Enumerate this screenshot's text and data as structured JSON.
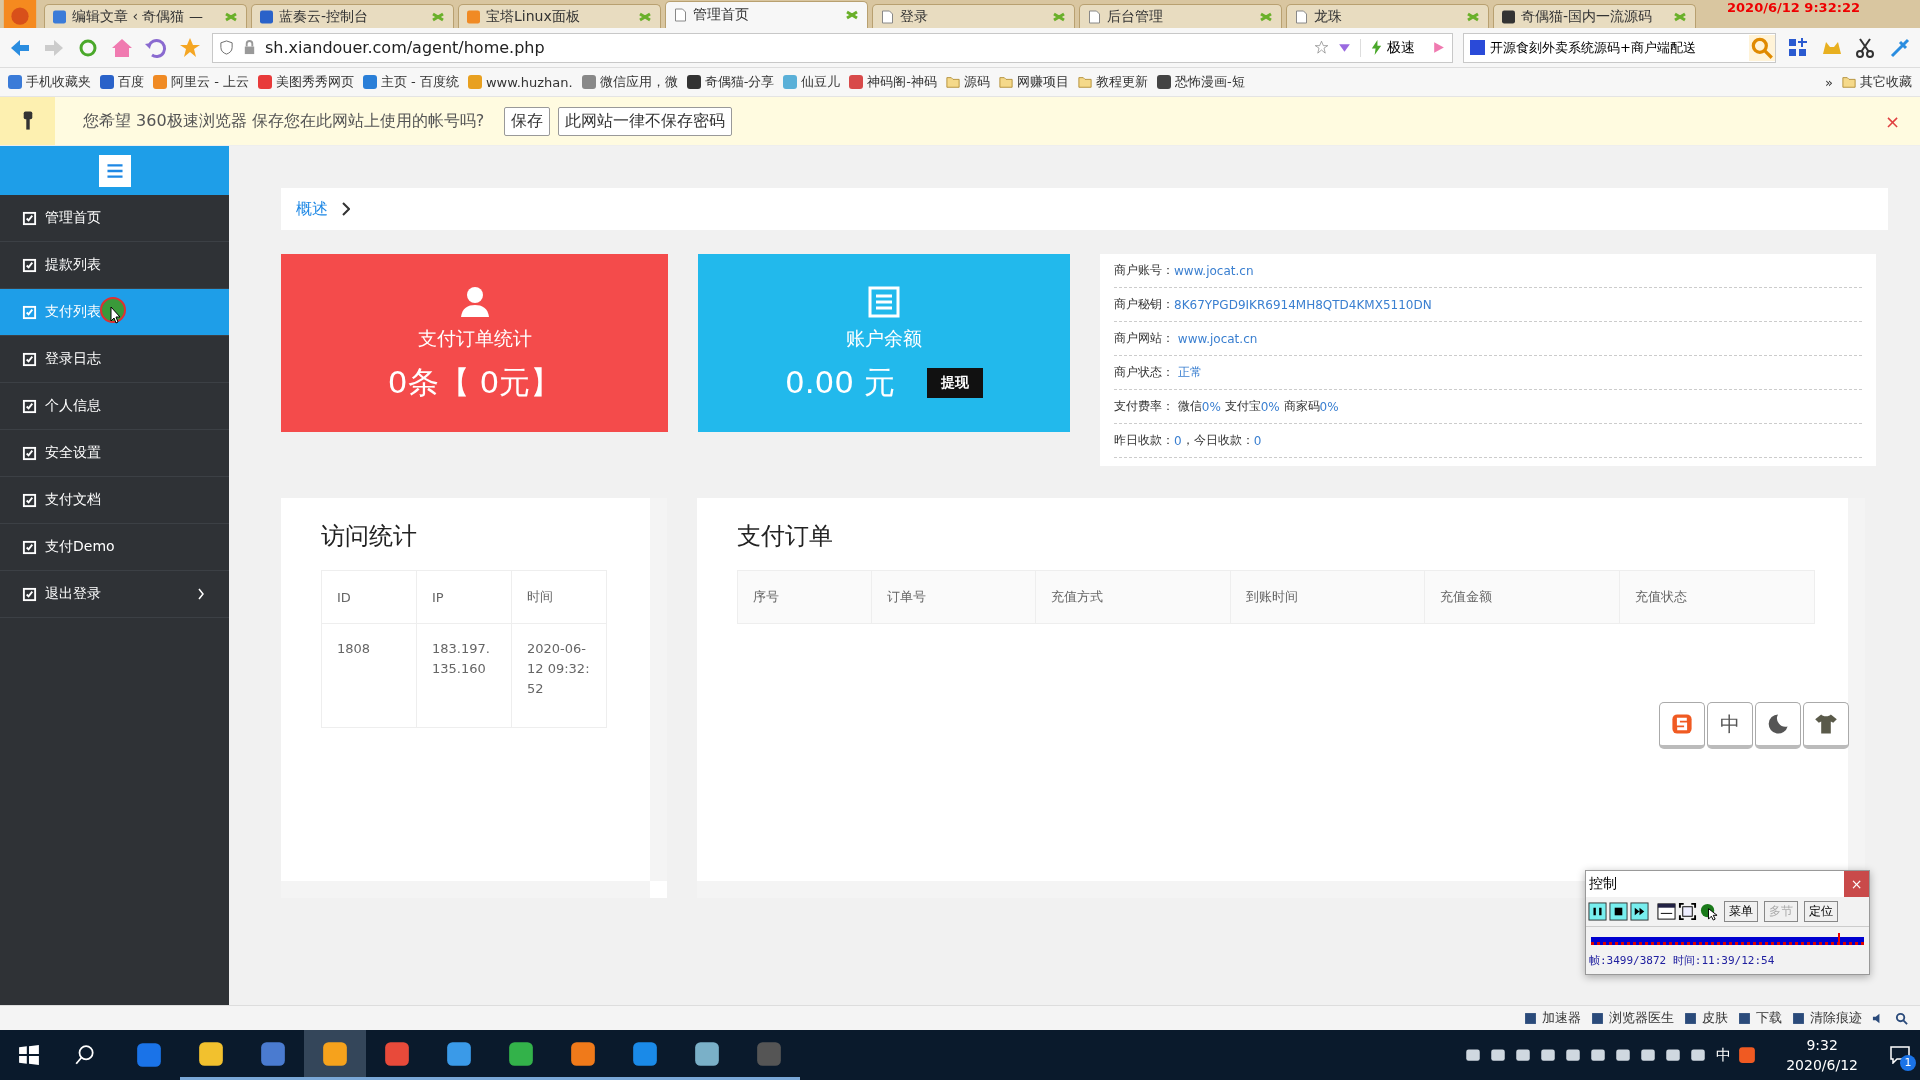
{
  "browser": {
    "tabs": [
      {
        "label": "编辑文章 ‹ 奇偶猫 —",
        "kind": "site",
        "selected": false
      },
      {
        "label": "蓝奏云-控制台",
        "kind": "site",
        "selected": false
      },
      {
        "label": "宝塔Linux面板",
        "kind": "site",
        "selected": false
      },
      {
        "label": "管理首页",
        "kind": "page",
        "selected": true
      },
      {
        "label": "登录",
        "kind": "page",
        "selected": false
      },
      {
        "label": "后台管理",
        "kind": "page",
        "selected": false
      },
      {
        "label": "龙珠",
        "kind": "page",
        "selected": false
      },
      {
        "label": "奇偶猫-国内一流源码",
        "kind": "site",
        "selected": false
      }
    ],
    "recording_time": "2020/6/12 9:32:22",
    "address": "sh.xiandouer.com/agent/home.php",
    "speed_mode": "极速",
    "search": {
      "value": "开源食刻外卖系统源码+商户端配送"
    },
    "bookmarks": [
      {
        "label": "手机收藏夹",
        "kind": "site"
      },
      {
        "label": "百度",
        "kind": "site"
      },
      {
        "label": "阿里云 - 上云",
        "kind": "site"
      },
      {
        "label": "美图秀秀网页",
        "kind": "site"
      },
      {
        "label": "主页 - 百度统",
        "kind": "site"
      },
      {
        "label": "www.huzhan.",
        "kind": "site"
      },
      {
        "label": "微信应用，微",
        "kind": "site"
      },
      {
        "label": "奇偶猫-分享",
        "kind": "site"
      },
      {
        "label": "仙豆儿",
        "kind": "site"
      },
      {
        "label": "神码阁-神码",
        "kind": "site"
      },
      {
        "label": "源码",
        "kind": "folder"
      },
      {
        "label": "网赚项目",
        "kind": "folder"
      },
      {
        "label": "教程更新",
        "kind": "folder"
      },
      {
        "label": "恐怖漫画-短",
        "kind": "site"
      }
    ],
    "bookmarks_more": "»",
    "other_bookmarks": "其它收藏",
    "password_bar": {
      "message": "您希望 360极速浏览器 保存您在此网站上使用的帐号吗?",
      "buttons": [
        "保存",
        "此网站一律不保存密码"
      ],
      "close": "×"
    }
  },
  "sidebar": {
    "items": [
      {
        "label": "管理首页",
        "selected": false
      },
      {
        "label": "提款列表",
        "selected": false
      },
      {
        "label": "支付列表",
        "selected": true
      },
      {
        "label": "登录日志",
        "selected": false
      },
      {
        "label": "个人信息",
        "selected": false
      },
      {
        "label": "安全设置",
        "selected": false
      },
      {
        "label": "支付文档",
        "selected": false
      },
      {
        "label": "支付Demo",
        "selected": false
      },
      {
        "label": "退出登录",
        "selected": false
      }
    ]
  },
  "breadcrumb": "概述",
  "stats": [
    {
      "title": "支付订单统计",
      "value": "0条【 0元】",
      "color": "#f44b4b"
    },
    {
      "title": "账户余额",
      "value": "0.00 元",
      "button": "提现",
      "color": "#22b9ec"
    }
  ],
  "merchant_info": [
    {
      "parts": [
        {
          "text": "商户账号：",
          "kind": "label"
        },
        {
          "text": "www.jocat.cn",
          "kind": "value"
        }
      ]
    },
    {
      "parts": [
        {
          "text": "商户秘钥：",
          "kind": "label"
        },
        {
          "text": "8K67YPGD9IKR6914MH8QTD4KMX5110DN",
          "kind": "value"
        }
      ]
    },
    {
      "parts": [
        {
          "text": "商户网站： ",
          "kind": "label"
        },
        {
          "text": "www.jocat.cn",
          "kind": "value"
        }
      ]
    },
    {
      "parts": [
        {
          "text": "商户状态： ",
          "kind": "label"
        },
        {
          "text": "正常",
          "kind": "value"
        }
      ]
    },
    {
      "parts": [
        {
          "text": "支付费率： 微信",
          "kind": "label"
        },
        {
          "text": "0%",
          "kind": "value"
        },
        {
          "text": " 支付宝",
          "kind": "label"
        },
        {
          "text": "0%",
          "kind": "value"
        },
        {
          "text": " 商家码",
          "kind": "label"
        },
        {
          "text": "0%",
          "kind": "value"
        }
      ]
    },
    {
      "parts": [
        {
          "text": "昨日收款：",
          "kind": "label"
        },
        {
          "text": "0",
          "kind": "value"
        },
        {
          "text": "，今日收款：",
          "kind": "label"
        },
        {
          "text": "0",
          "kind": "value"
        }
      ]
    }
  ],
  "visits": {
    "title": "访问统计",
    "columns": [
      "ID",
      "IP",
      "时间"
    ],
    "rows": [
      [
        "1808",
        "183.197.135.160",
        "2020-06-12 09:32:52"
      ]
    ]
  },
  "orders": {
    "title": "支付订单",
    "columns": [
      "序号",
      "订单号",
      "充值方式",
      "到账时间",
      "充值金额",
      "充值状态"
    ]
  },
  "ime_toolbar": {
    "mode": "中"
  },
  "control_window": {
    "title": "控制",
    "close": "×",
    "buttons": [
      {
        "label": "菜单",
        "disabled": false
      },
      {
        "label": "多节",
        "disabled": true
      },
      {
        "label": "定位",
        "disabled": false
      }
    ],
    "level": 0.904,
    "status": "帧:3499/3872 时间:11:39/12:54"
  },
  "status_bar": [
    "加速器",
    "浏览器医生",
    "皮肤",
    "下载",
    "清除痕迹"
  ],
  "taskbar": {
    "apps": [
      {
        "running": false,
        "selected": false
      },
      {
        "running": true,
        "selected": false
      },
      {
        "running": true,
        "selected": false
      },
      {
        "running": true,
        "selected": true
      },
      {
        "running": true,
        "selected": false
      },
      {
        "running": true,
        "selected": false
      },
      {
        "running": true,
        "selected": false
      },
      {
        "running": true,
        "selected": false
      },
      {
        "running": true,
        "selected": false
      },
      {
        "running": true,
        "selected": false
      },
      {
        "running": true,
        "selected": false
      }
    ],
    "input_mode": "中",
    "time": "9:32",
    "date": "2020/6/12",
    "notifications": "1"
  }
}
